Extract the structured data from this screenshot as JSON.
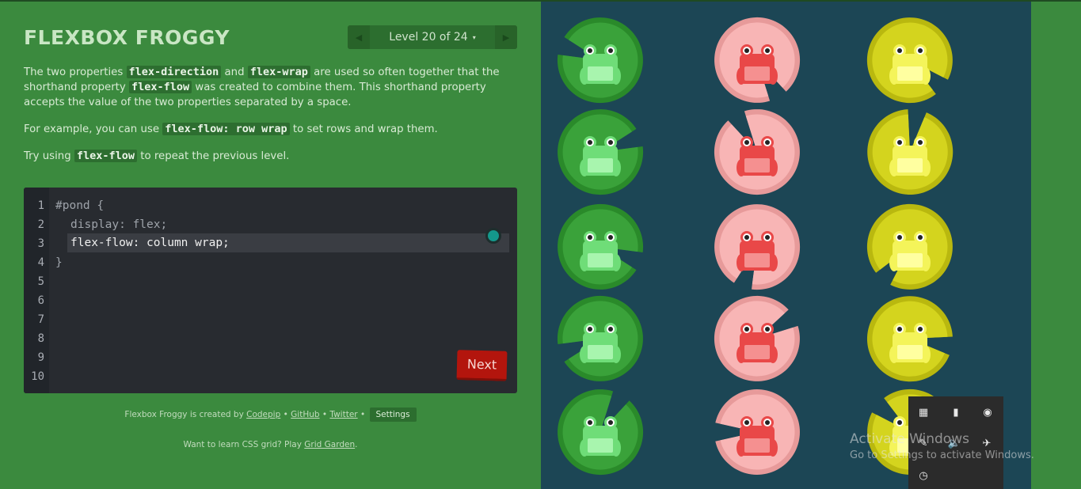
{
  "app": {
    "title": "FLEXBOX FROGGY"
  },
  "level_nav": {
    "prev_icon": "triangle-left-icon",
    "next_icon": "triangle-right-icon",
    "level_label": "Level 20 of 24",
    "caret": "▾"
  },
  "instructions": {
    "p1": {
      "t1": "The two properties ",
      "c1": "flex-direction",
      "t2": " and ",
      "c2": "flex-wrap",
      "t3": " are used so often together that the shorthand property ",
      "c3": "flex-flow",
      "t4": " was created to combine them. This shorthand property accepts the value of the two properties separated by a space."
    },
    "p2": {
      "t1": "For example, you can use ",
      "c1": "flex-flow: row wrap",
      "t2": " to set rows and wrap them."
    },
    "p3": {
      "t1": "Try using ",
      "c1": "flex-flow",
      "t2": " to repeat the previous level."
    }
  },
  "editor": {
    "line_numbers": [
      "1",
      "2",
      "3",
      "4",
      "5",
      "6",
      "7",
      "8",
      "9",
      "10"
    ],
    "line1": "#pond {",
    "line2": "display: flex;",
    "input_value": "flex-flow: column wrap;",
    "line4": "}",
    "next_label": "Next"
  },
  "credits": {
    "prefix": "Flexbox Froggy is created by ",
    "codepip": "Codepip",
    "sep": " • ",
    "github": "GitHub",
    "twitter": "Twitter",
    "settings": "Settings"
  },
  "grid_promo": {
    "prefix": "Want to learn CSS grid? Play ",
    "link": "Grid Garden",
    "suffix": "."
  },
  "pond": {
    "columns": [
      {
        "color": "green",
        "pad": "#3aa23a",
        "pad_dark": "#2a8a2a",
        "frog": "#6fdd78",
        "frog_light": "#a8f5ae"
      },
      {
        "color": "red",
        "pad": "#f8b5b5",
        "pad_dark": "#e79a9a",
        "frog": "#e94848",
        "frog_light": "#f59090"
      },
      {
        "color": "yellow",
        "pad": "#d4d41e",
        "pad_dark": "#b9b80f",
        "frog": "#f4f45a",
        "frog_light": "#ffffa0"
      }
    ],
    "rows": 5
  },
  "windows": {
    "activate_title": "Activate Windows",
    "activate_sub": "Go to Settings to activate Windows.",
    "tray_icons": [
      "app-icon",
      "usb-icon",
      "chrome-icon",
      "feather-icon",
      "volume-icon",
      "network-icon",
      "clock-icon"
    ]
  }
}
